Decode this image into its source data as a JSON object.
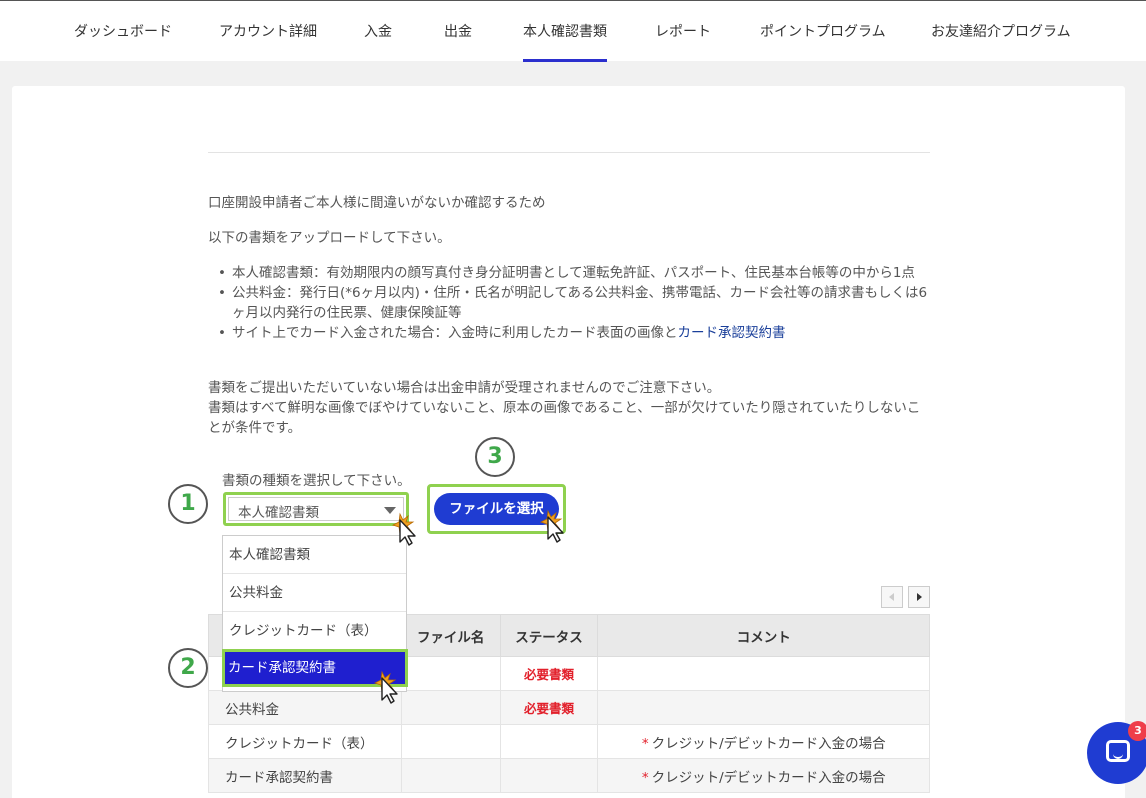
{
  "nav": {
    "tabs": [
      {
        "label": "ダッシュボード"
      },
      {
        "label": "アカウント詳細"
      },
      {
        "label": "入金"
      },
      {
        "label": "出金"
      },
      {
        "label": "本人確認書類",
        "active": true
      },
      {
        "label": "レポート"
      },
      {
        "label": "ポイントプログラム"
      },
      {
        "label": "お友達紹介プログラム"
      }
    ],
    "active_color": "#2b2fce"
  },
  "intro": {
    "line1": "口座開設申請者ご本人様に間違いがないか確認するため",
    "line2": "以下の書類をアップロードして下さい。"
  },
  "requirements": [
    {
      "text": "本人確認書類：有効期限内の顔写真付き身分証明書として運転免許証、パスポート、住民基本台帳等の中から1点"
    },
    {
      "text": "公共料金：発行日(*6ヶ月以内)・住所・氏名が明記してある公共料金、携帯電話、カード会社等の請求書もしくは6ヶ月以内発行の住民票、健康保険証等"
    },
    {
      "text": "サイト上でカード入金された場合：入金時に利用したカード表面の画像と",
      "link": "カード承認契約書"
    }
  ],
  "notice": {
    "line1": "書類をご提出いただいていない場合は出金申請が受理されませんのでご注意下さい。",
    "line2": "書類はすべて鮮明な画像でぼやけていないこと、原本の画像であること、一部が欠けていたり隠されていたりしないことが条件です。"
  },
  "doc_select": {
    "label": "書類の種類を選択して下さい。",
    "value": "本人確認書類",
    "options": [
      "本人確認書類",
      "公共料金",
      "クレジットカード（表）",
      "カード承認契約書"
    ],
    "highlighted_option": "カード承認契約書"
  },
  "file_button": {
    "label": "ファイルを選択"
  },
  "steps": {
    "one": "1",
    "two": "2",
    "three": "3"
  },
  "table": {
    "headers": [
      "",
      "ファイル名",
      "ステータス",
      "コメント"
    ],
    "rows": [
      {
        "name": "",
        "file": "",
        "status": "必要書類",
        "comment": ""
      },
      {
        "name": "公共料金",
        "file": "",
        "status": "必要書類",
        "comment": ""
      },
      {
        "name": "クレジットカード（表）",
        "file": "",
        "status": "",
        "comment_mark": "*",
        "comment": "クレジット/デビットカード入金の場合"
      },
      {
        "name": "カード承認契約書",
        "file": "",
        "status": "",
        "comment_mark": "*",
        "comment": "クレジット/デビットカード入金の場合"
      }
    ]
  },
  "chat": {
    "badge_count": "3"
  },
  "colors": {
    "highlight_green": "#8fd14f",
    "primary_blue": "#1f3cd2",
    "required_red": "#e2202b",
    "step_number_green": "#3fa84a"
  }
}
